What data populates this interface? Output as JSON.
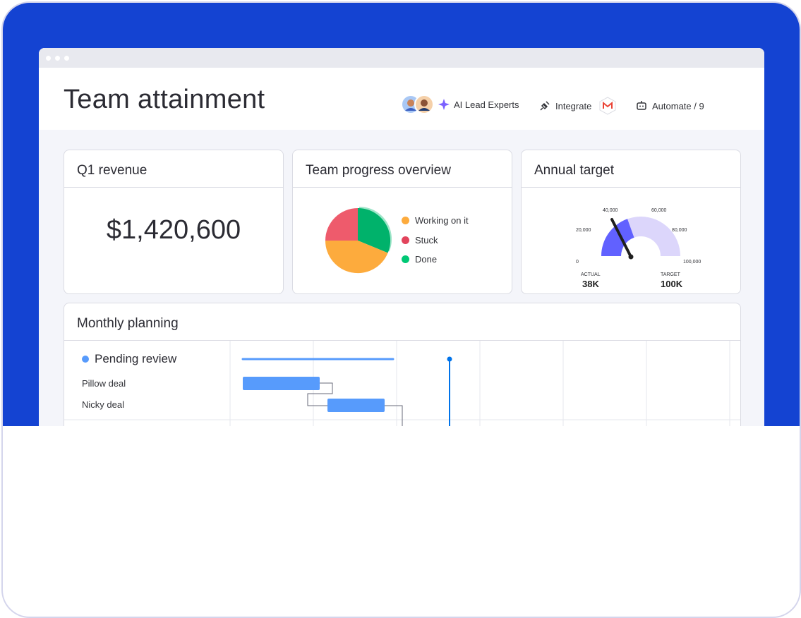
{
  "header": {
    "title": "Team attainment",
    "ai_label": "AI Lead Experts",
    "integrate_label": "Integrate",
    "automate_label": "Automate / 9"
  },
  "widgets": {
    "revenue": {
      "title": "Q1 revenue",
      "value": "$1,420,600"
    },
    "progress": {
      "title": "Team progress overview",
      "legend": [
        {
          "label": "Working on it",
          "color": "#fdab3d"
        },
        {
          "label": "Stuck",
          "color": "#e2445c"
        },
        {
          "label": "Done",
          "color": "#00c875"
        }
      ]
    },
    "target": {
      "title": "Annual target",
      "ticks": [
        "0",
        "20,000",
        "40,000",
        "60,000",
        "80,000",
        "100,000"
      ],
      "actual_caption": "ACTUAL",
      "actual_value": "38K",
      "target_caption": "TARGET",
      "target_value": "100K"
    }
  },
  "planning": {
    "title": "Monthly planning",
    "group": "Pending review",
    "rows": [
      "Pillow deal",
      "Nicky deal"
    ]
  },
  "colors": {
    "frame_blue": "#1443d2",
    "bar_blue": "#579bfc",
    "today_line": "#0073ea"
  }
}
